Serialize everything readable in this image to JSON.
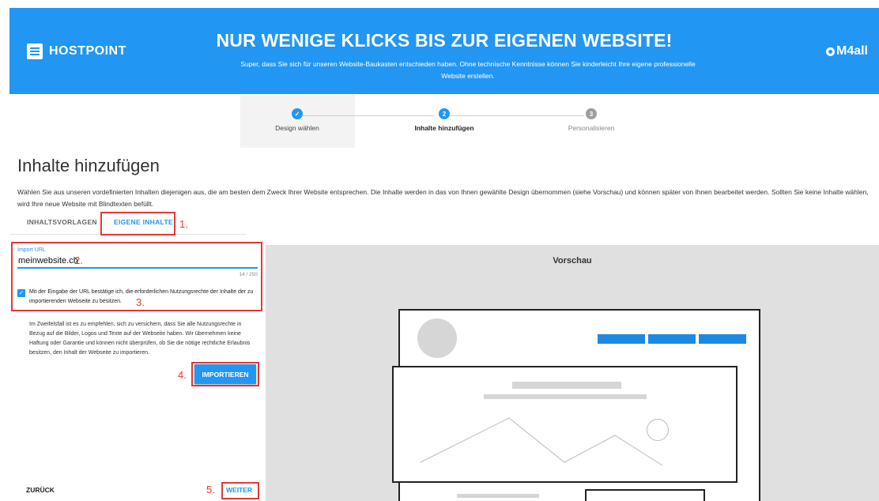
{
  "header": {
    "brand": "HOSTPOINT",
    "title": "NUR WENIGE KLICKS BIS ZUR EIGENEN WEBSITE!",
    "subtitle": "Super, dass Sie sich für unseren Website-Baukasten entschieden haben. Ohne technische Kenntnisse können Sie kinderleicht Ihre eigene professionelle Website erstellen.",
    "partner": "M4all"
  },
  "steps": [
    {
      "label": "Design wählen",
      "status": "done",
      "marker": "✓"
    },
    {
      "label": "Inhalte hinzufügen",
      "status": "active",
      "marker": "2"
    },
    {
      "label": "Personalisieren",
      "status": "todo",
      "marker": "3"
    }
  ],
  "page": {
    "title": "Inhalte hinzufügen",
    "intro": "Wählen Sie aus unseren vordefinierten Inhalten diejenigen aus, die am besten dem Zweck Ihrer Website entsprechen. Die Inhalte werden in das von Ihnen gewählte Design übernommen (siehe Vorschau) und können später von Ihnen bearbeitet werden. Sollten Sie keine Inhalte wählen, wird Ihre neue Website mit Blindtexten befüllt."
  },
  "tabs": {
    "inactive": "INHALTSVORLAGEN",
    "active": "EIGENE INHALTE"
  },
  "form": {
    "url_label": "Import URL",
    "url_value": "meinwebsite.ch",
    "counter": "14 / 250",
    "checkbox_checked": true,
    "checkbox_text": "Mit der Eingabe der URL bestätige ich, die erforderlichen Nutzungsrechte der Inhalte der zu importierenden Webseite zu besitzen.",
    "note": "Im Zweifelsfall ist es zu empfehlen, sich zu versichern, dass Sie alle Nutzungsrechte in Bezug auf die Bilder, Logos und Texte auf der Webseite haben. Wir übernehmen keine Haftung oder Garantie und können nicht überprüfen, ob Sie die nötige rechtliche Erlaubnis besitzen, den Inhalt der Webseite zu importieren.",
    "import_button": "IMPORTIEREN",
    "back_button": "ZURÜCK",
    "next_button": "WEITER"
  },
  "annotations": [
    "1.",
    "2.",
    "3.",
    "4.",
    "5."
  ],
  "preview": {
    "title": "Vorschau"
  },
  "colors": {
    "accent": "#2196f3",
    "annotation": "#e53935"
  }
}
